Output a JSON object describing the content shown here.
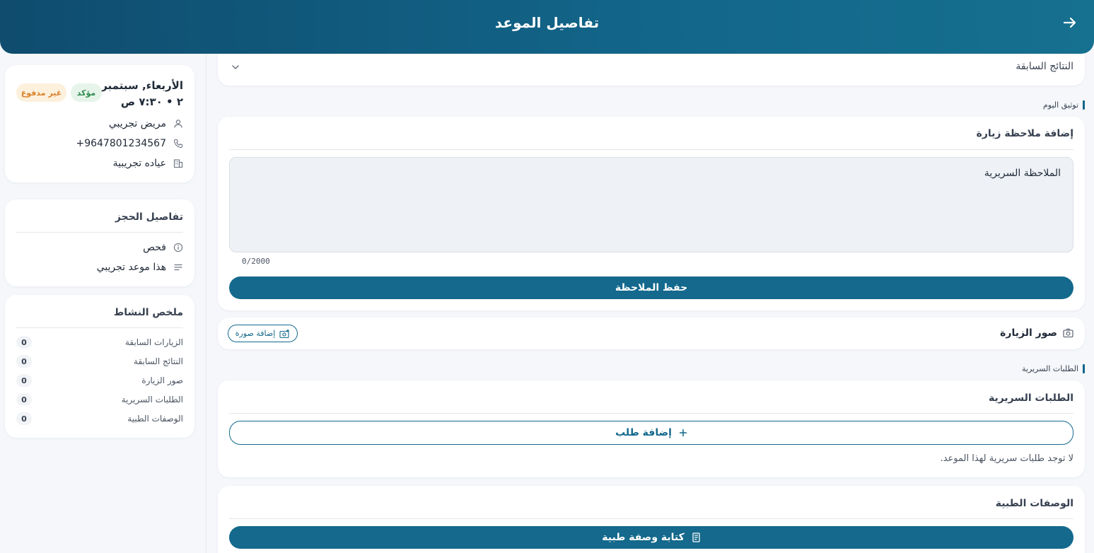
{
  "header": {
    "title": "تفاصيل الموعد",
    "back_icon": "arrow-right-icon"
  },
  "appointment": {
    "date_time": "الأربعاء, سبتمبر ٢ • ٧:٣٠ ص",
    "status": "مؤكد",
    "payment": "غير مدفوع",
    "patient": "مريض تجريبي",
    "phone": "+9647801234567",
    "clinic": "عياده تجريبية"
  },
  "booking": {
    "title": "تفاصيل الحجز",
    "type": "فحص",
    "note": "هذا موعد تجريبي"
  },
  "activity": {
    "title": "ملخص النشاط",
    "items": [
      {
        "label": "الزيارات السابقة",
        "count": "0"
      },
      {
        "label": "النتائج السابقة",
        "count": "0"
      },
      {
        "label": "صور الزيارة",
        "count": "0"
      },
      {
        "label": "الطلبات السريرية",
        "count": "0"
      },
      {
        "label": "الوصفات الطبية",
        "count": "0"
      }
    ]
  },
  "previous_results": {
    "label": "النتائج السابقة"
  },
  "today_doc": {
    "section_label": "توثيق اليوم",
    "card_title": "إضافة ملاحظة زيارة",
    "note_placeholder": "الملاحظة السريرية",
    "char_count": "0/2000",
    "save_label": "حفظ الملاحظة"
  },
  "photos": {
    "title": "صور الزيارة",
    "add_label": "إضافة صورة"
  },
  "orders": {
    "section_label": "الطلبات السريرية",
    "card_title": "الطلبات السريرية",
    "add_label": "إضافة طلب",
    "empty_text": "لا توجد طلبات سريرية لهذا الموعد."
  },
  "prescriptions": {
    "card_title": "الوصفات الطبية",
    "write_label": "كتابة وصفة طبية"
  },
  "colors": {
    "primary": "#14698c",
    "header_start": "#0f4c6e",
    "confirmed": "#2e8b4e",
    "unpaid": "#d9822b"
  }
}
